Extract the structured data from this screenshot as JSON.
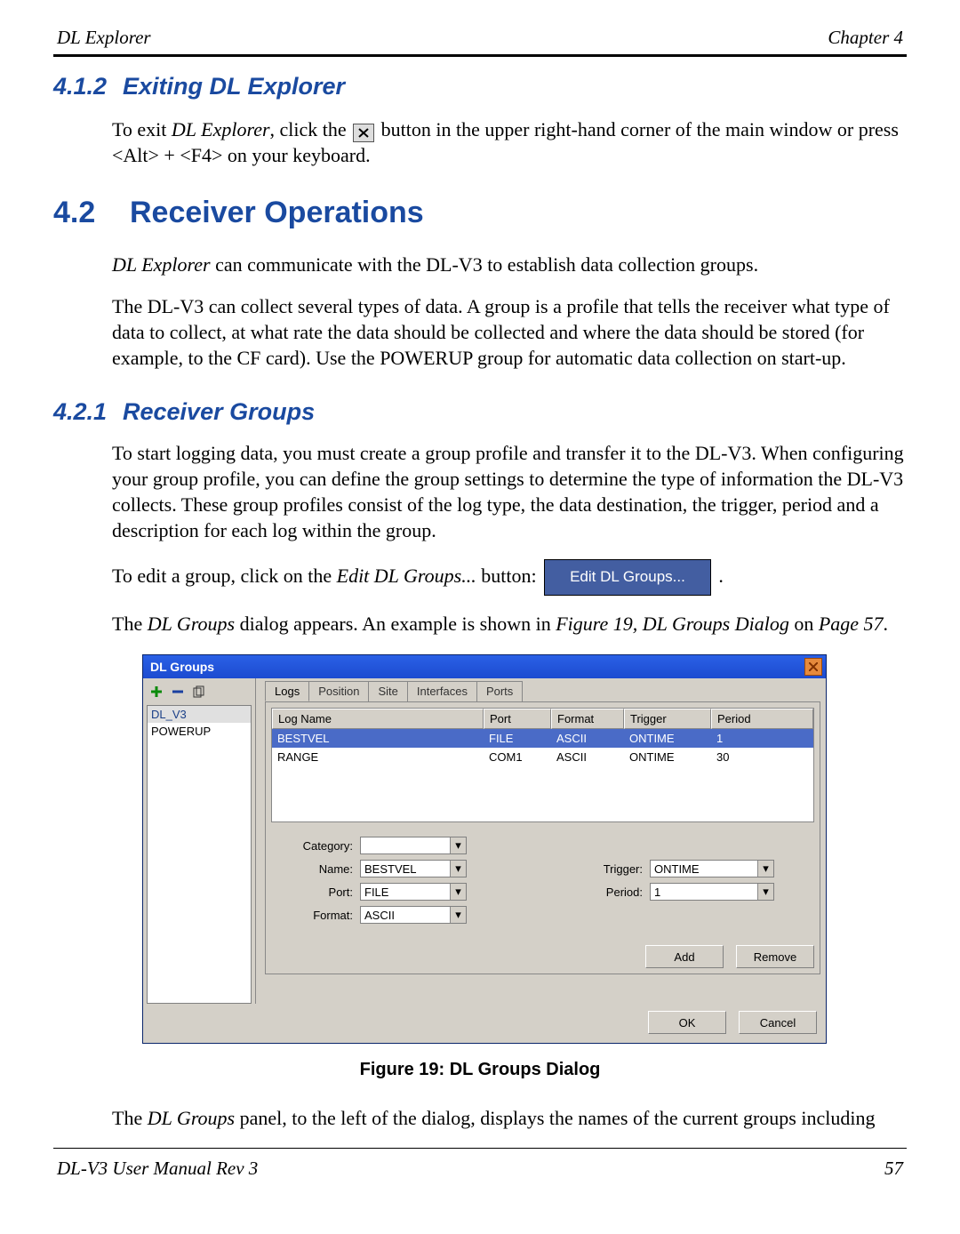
{
  "header": {
    "left": "DL Explorer",
    "right": "Chapter 4"
  },
  "footer": {
    "left": "DL-V3 User Manual Rev 3",
    "right": "57"
  },
  "sec412": {
    "num": "4.1.2",
    "title": "Exiting DL Explorer",
    "p1a": "To exit ",
    "p1b": "DL Explorer",
    "p1c": ", click the ",
    "p1d": " button in the upper right-hand corner of the main window or press <Alt> + <F4> on your keyboard."
  },
  "sec42": {
    "num": "4.2",
    "title": "Receiver Operations",
    "p1a": "DL Explorer",
    "p1b": " can communicate with the DL-V3 to establish data collection groups.",
    "p2": "The DL-V3 can collect several types of data. A group is a profile that tells the receiver what type of data to collect, at what rate the data should be collected and where the data should be stored (for example, to the CF card). Use the POWERUP group for automatic data collection on start-up."
  },
  "sec421": {
    "num": "4.2.1",
    "title": "Receiver Groups",
    "p1": "To start logging data, you must create a group profile and transfer it to the DL-V3. When configuring your group profile, you can define the group settings to determine the type of information the DL-V3 collects. These group profiles consist of the log type, the data destination, the trigger, period and a description for each log within the group.",
    "p2a": "To edit a group, click on the ",
    "p2b": "Edit DL Groups...",
    "p2c": " button: ",
    "editBtn": "Edit DL Groups...",
    "p2d": ".",
    "p3a": "The ",
    "p3b": "DL Groups",
    "p3c": " dialog appears. An example is shown in ",
    "p3d": "Figure 19, DL Groups Dialog",
    "p3e": " on ",
    "p3f": "Page 57",
    "p3g": "."
  },
  "dialog": {
    "title": "DL Groups",
    "groups": [
      "DL_V3",
      "POWERUP"
    ],
    "tabs": [
      "Logs",
      "Position",
      "Site",
      "Interfaces",
      "Ports"
    ],
    "columns": {
      "name": "Log Name",
      "port": "Port",
      "format": "Format",
      "trigger": "Trigger",
      "period": "Period"
    },
    "rows": [
      {
        "name": "BESTVEL",
        "port": "FILE",
        "format": "ASCII",
        "trigger": "ONTIME",
        "period": "1"
      },
      {
        "name": "RANGE",
        "port": "COM1",
        "format": "ASCII",
        "trigger": "ONTIME",
        "period": "30"
      }
    ],
    "fields": {
      "category_lab": "Category:",
      "category_val": "",
      "name_lab": "Name:",
      "name_val": "BESTVEL",
      "port_lab": "Port:",
      "port_val": "FILE",
      "format_lab": "Format:",
      "format_val": "ASCII",
      "trigger_lab": "Trigger:",
      "trigger_val": "ONTIME",
      "period_lab": "Period:",
      "period_val": "1"
    },
    "buttons": {
      "add": "Add",
      "remove": "Remove",
      "ok": "OK",
      "cancel": "Cancel"
    }
  },
  "figcap": "Figure 19: DL Groups Dialog",
  "tail": {
    "a": "The ",
    "b": "DL Groups",
    "c": " panel, to the left of the dialog, displays the names of the current groups including"
  }
}
